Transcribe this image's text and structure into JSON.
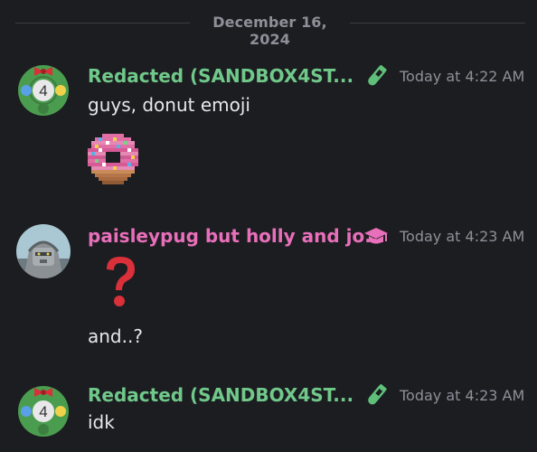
{
  "date_divider": {
    "label": "December 16, 2024"
  },
  "colors": {
    "background": "#1c1d21",
    "green_name": "#70c98a",
    "pink_name": "#e86fb9",
    "timestamp": "#8e9098",
    "message_text": "#e6e7ea"
  },
  "messages": [
    {
      "author": "Redacted (SANDBOX4ST...",
      "avatar_icon": "wreath-avatar-icon",
      "avatar_badge": "4",
      "role_icon": "test-tube-icon",
      "timestamp": "Today at 4:22 AM",
      "text": "guys, donut emoji",
      "attachment_icon": "donut-emoji-icon"
    },
    {
      "author": "paisleypug but holly and jo...",
      "avatar_icon": "robot-avatar-icon",
      "role_icon": "graduation-cap-icon",
      "timestamp": "Today at 4:23 AM",
      "emoji_icon": "question-mark-emoji-icon",
      "text": "and..?"
    },
    {
      "author": "Redacted (SANDBOX4ST...",
      "avatar_icon": "wreath-avatar-icon",
      "avatar_badge": "4",
      "role_icon": "test-tube-icon",
      "timestamp": "Today at 4:23 AM",
      "text": "idk"
    }
  ]
}
